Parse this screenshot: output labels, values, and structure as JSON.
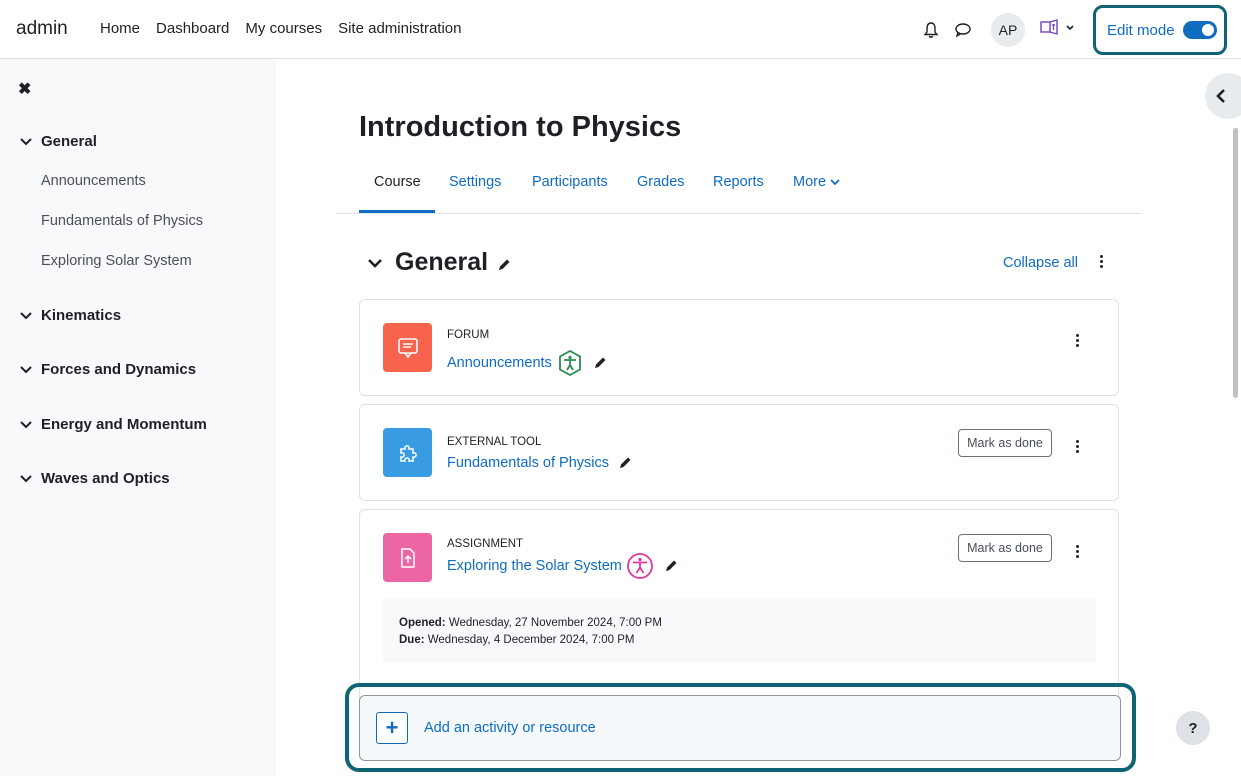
{
  "navbar": {
    "brand": "admin",
    "links": [
      "Home",
      "Dashboard",
      "My courses",
      "Site administration"
    ],
    "avatar_initials": "AP",
    "edit_mode_label": "Edit mode",
    "edit_mode_on": true
  },
  "drawer": {
    "sections": [
      {
        "title": "General",
        "items": [
          "Announcements",
          "Fundamentals of Physics",
          "Exploring Solar System"
        ]
      },
      {
        "title": "Kinematics",
        "items": []
      },
      {
        "title": "Forces and Dynamics",
        "items": []
      },
      {
        "title": "Energy and Momentum",
        "items": []
      },
      {
        "title": "Waves and Optics",
        "items": []
      }
    ]
  },
  "course": {
    "title": "Introduction to Physics",
    "tabs": [
      "Course",
      "Settings",
      "Participants",
      "Grades",
      "Reports",
      "More"
    ],
    "active_tab": "Course"
  },
  "section": {
    "title": "General",
    "collapse_all_label": "Collapse all"
  },
  "activities": [
    {
      "type": "FORUM",
      "name": "Announcements",
      "color": "#f7634d",
      "icon": "forum-icon"
    },
    {
      "type": "EXTERNAL TOOL",
      "name": "Fundamentals of Physics",
      "color": "#399be2",
      "icon": "puzzle-icon",
      "mark_done": "Mark as done"
    },
    {
      "type": "ASSIGNMENT",
      "name": "Exploring the Solar System",
      "color": "#eb66a2",
      "icon": "assignment-icon",
      "mark_done": "Mark as done",
      "opened_label": "Opened:",
      "opened_value": "Wednesday, 27 November 2024, 7:00 PM",
      "due_label": "Due:",
      "due_value": "Wednesday, 4 December 2024, 7:00 PM"
    }
  ],
  "add_activity_label": "Add an activity or resource",
  "help_label": "?",
  "colors": {
    "link": "#0f6cbf",
    "highlight": "#0f6374"
  }
}
